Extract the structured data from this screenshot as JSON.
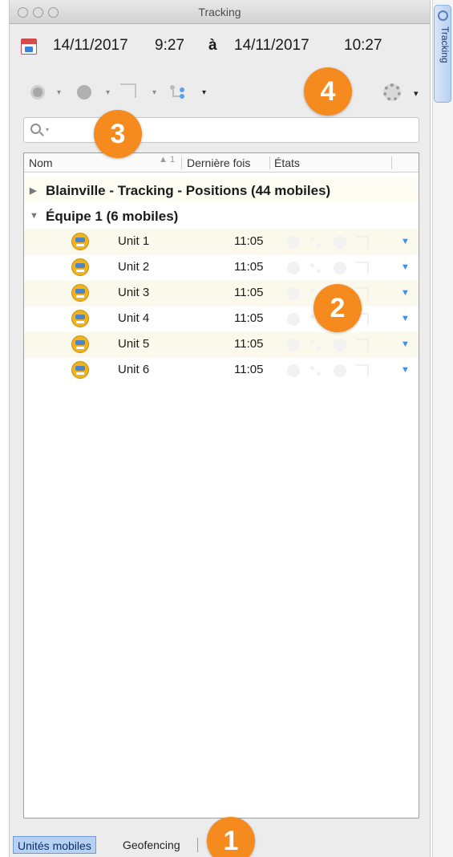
{
  "window": {
    "title": "Tracking"
  },
  "date_range": {
    "start_date": "14/11/2017",
    "start_time": "9:27",
    "separator": "à",
    "end_date": "14/11/2017",
    "end_time": "10:27"
  },
  "toolbar": {
    "icons": [
      "circle-filter-icon",
      "circle-icon",
      "route-icon",
      "tree-icon",
      "gear-icon"
    ]
  },
  "search": {
    "placeholder": "",
    "value": ""
  },
  "table": {
    "columns": [
      "Nom",
      "Dernière fois",
      "États"
    ],
    "sort_indicator": "1",
    "groups": [
      {
        "label": "Blainville - Tracking - Positions (44 mobiles)",
        "expanded": false
      },
      {
        "label": "Équipe 1 (6 mobiles)",
        "expanded": true
      }
    ],
    "rows": [
      {
        "name": "Unit 1",
        "time": "11:05"
      },
      {
        "name": "Unit 2",
        "time": "11:05"
      },
      {
        "name": "Unit 3",
        "time": "11:05"
      },
      {
        "name": "Unit 4",
        "time": "11:05"
      },
      {
        "name": "Unit 5",
        "time": "11:05"
      },
      {
        "name": "Unit 6",
        "time": "11:05"
      }
    ]
  },
  "bottom_tabs": {
    "active": "Unités mobiles",
    "other": "Geofencing"
  },
  "side_panel": {
    "label": "Tracking"
  },
  "callouts": [
    "1",
    "2",
    "3",
    "4"
  ],
  "colors": {
    "callout": "#f58a1f",
    "active_tab": "#b7d1f3",
    "row_alt": "#fbf9ec",
    "row_caret": "#3f8fe0"
  }
}
